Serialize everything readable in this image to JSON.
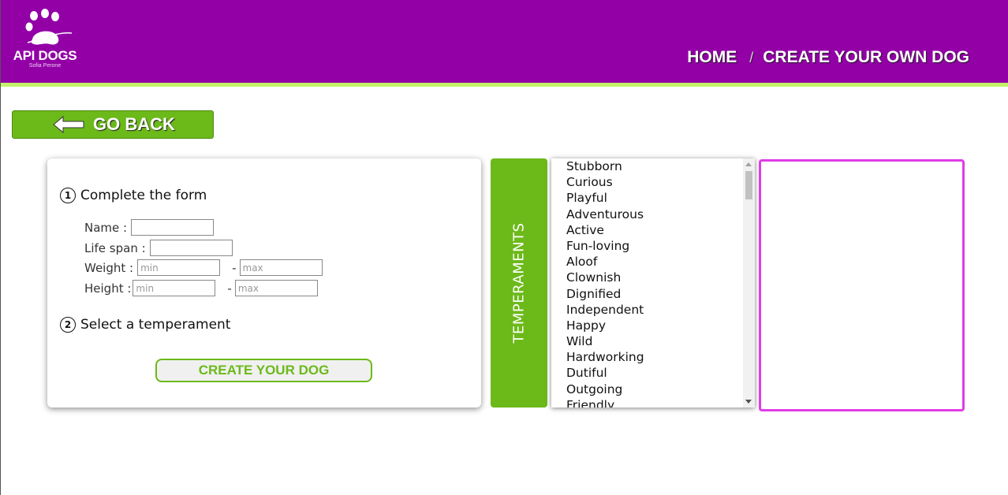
{
  "header": {
    "logo_title": "API DOGS",
    "logo_subtitle": "Sofia Perone",
    "nav_home": "HOME",
    "nav_separator": "/",
    "nav_current": "CREATE YOUR OWN DOG",
    "colors": {
      "background": "#9200a6",
      "accent_bar": "#c3f26a"
    }
  },
  "back_button": {
    "label": "GO BACK",
    "icon": "arrow-left-icon",
    "color": "#6cb91a"
  },
  "form": {
    "step1_number": "1",
    "step1_label": "Complete the form",
    "name_label": "Name :",
    "name_value": "",
    "lifespan_label": "Life span :",
    "lifespan_value": "",
    "weight_label": "Weight :",
    "weight_min_placeholder": "min",
    "weight_max_placeholder": "max",
    "height_label": "Height :",
    "height_min_placeholder": "min",
    "height_max_placeholder": "max",
    "range_dash": "-",
    "step2_number": "2",
    "step2_label": "Select a temperament",
    "create_button": "CREATE YOUR DOG"
  },
  "temperaments": {
    "tab_label": "TEMPERAMENTS",
    "items": [
      "Stubborn",
      "Curious",
      "Playful",
      "Adventurous",
      "Active",
      "Fun-loving",
      "Aloof",
      "Clownish",
      "Dignified",
      "Independent",
      "Happy",
      "Wild",
      "Hardworking",
      "Dutiful",
      "Outgoing",
      "Friendly"
    ]
  },
  "selected_temperaments": {
    "items": [],
    "border_color": "#e03ce8"
  }
}
